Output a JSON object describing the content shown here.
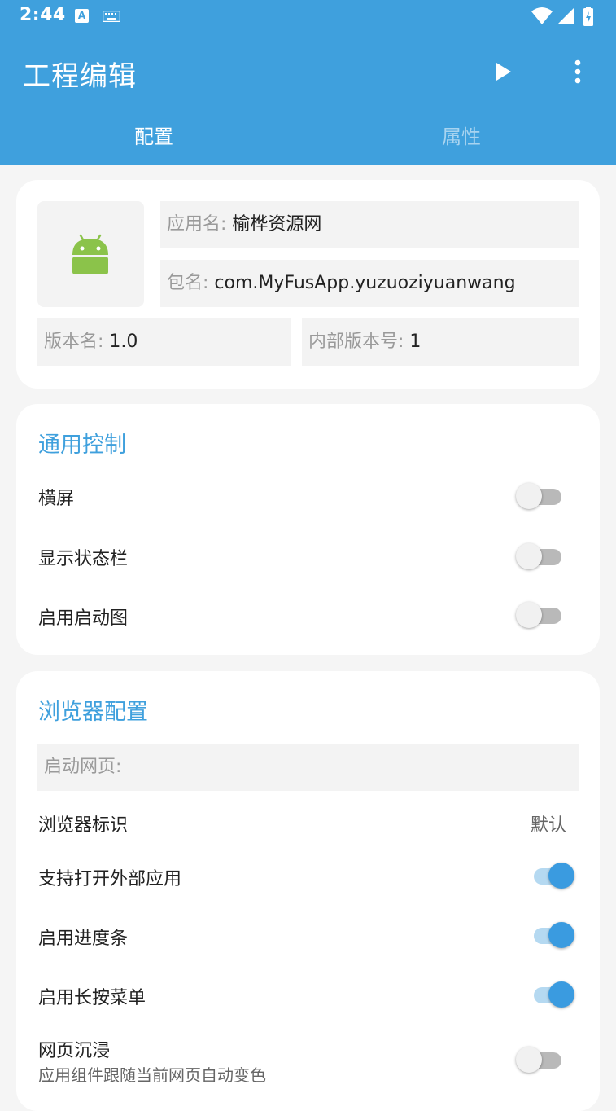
{
  "status_bar": {
    "time": "2:44",
    "icons": [
      "a-notification-icon",
      "keyboard-icon",
      "wifi-icon",
      "signal-icon",
      "battery-charging-icon"
    ]
  },
  "app_bar": {
    "title": "工程编辑",
    "actions": [
      "play-icon",
      "more-vert-icon"
    ]
  },
  "tabs": [
    {
      "label": "配置",
      "selected": true
    },
    {
      "label": "属性",
      "selected": false
    }
  ],
  "app_info": {
    "icon": "android-icon",
    "app_name": {
      "label": "应用名: ",
      "value": "榆桦资源网"
    },
    "package": {
      "label": "包名: ",
      "value": "com.MyFusApp.yuzuoziyuanwang"
    },
    "version_name": {
      "label": "版本名: ",
      "value": "1.0"
    },
    "version_code": {
      "label": "内部版本号: ",
      "value": "1"
    }
  },
  "general": {
    "title": "通用控制",
    "items": [
      {
        "label": "横屏",
        "on": false
      },
      {
        "label": "显示状态栏",
        "on": false
      },
      {
        "label": "启用启动图",
        "on": false
      }
    ]
  },
  "browser": {
    "title": "浏览器配置",
    "start_page_label": "启动网页:",
    "ua_label": "浏览器标识",
    "ua_value": "默认",
    "items": [
      {
        "label": "支持打开外部应用",
        "on": true
      },
      {
        "label": "启用进度条",
        "on": true
      },
      {
        "label": "启用长按菜单",
        "on": true
      }
    ],
    "immersive": {
      "label": "网页沉浸",
      "sub": "应用组件跟随当前网页自动变色",
      "on": false
    }
  },
  "colors": {
    "primary": "#3fa0dd",
    "switch_on": "#3a9be0",
    "switch_off_track": "#b9b9b9"
  }
}
